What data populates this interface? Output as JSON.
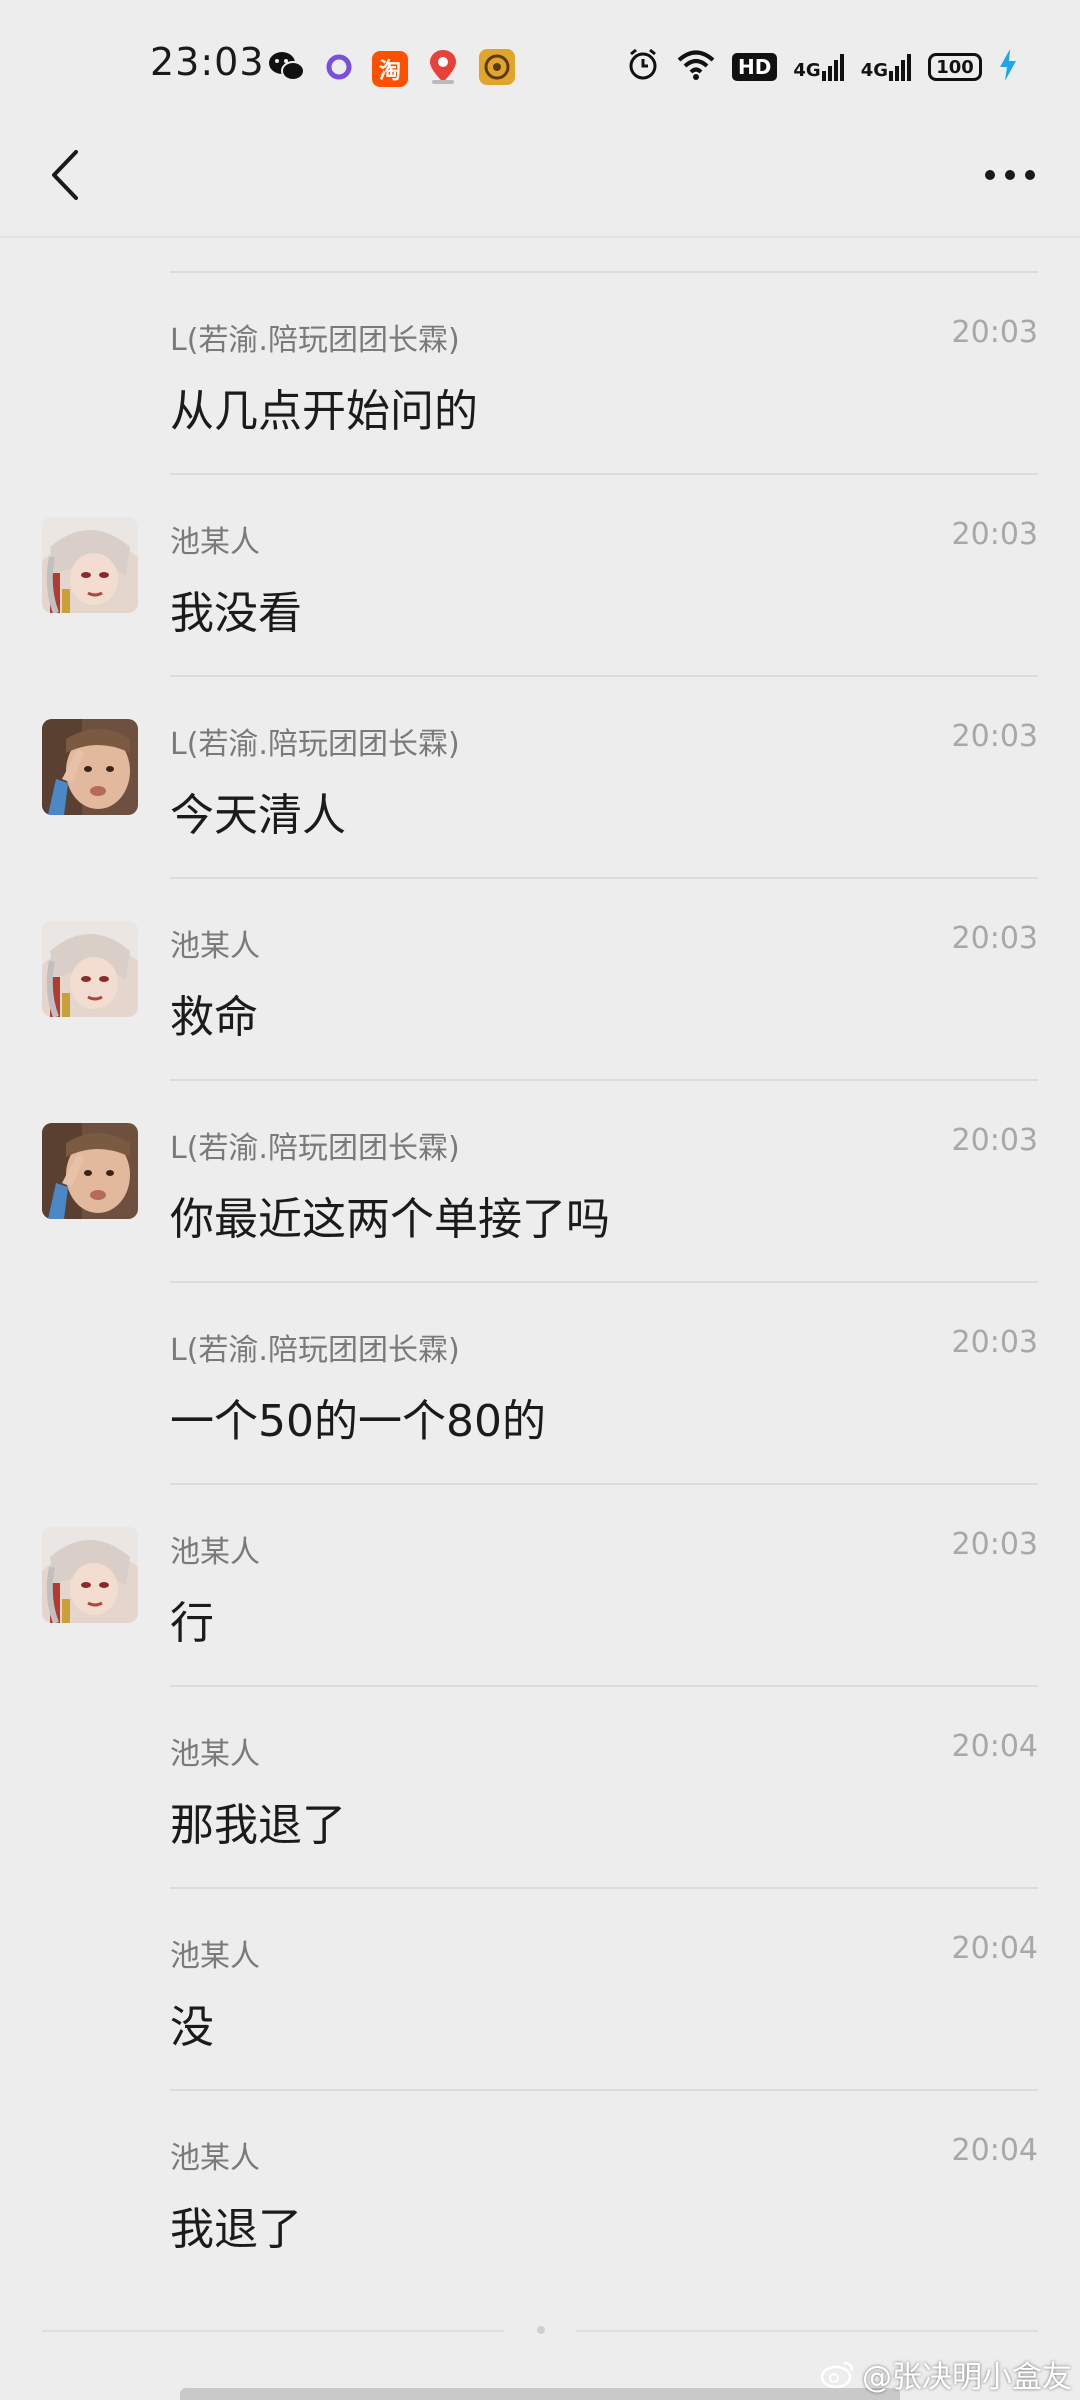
{
  "status_bar": {
    "time": "23:03",
    "taobao_label": "淘",
    "hd_label": "HD",
    "net1_label": "4G",
    "net2_label": "4G",
    "battery_level": "100",
    "icons": [
      "wechat-icon",
      "circle-app-icon",
      "taobao-icon",
      "map-pin-icon",
      "compass-app-icon",
      "alarm-icon",
      "wifi-icon",
      "signal-icon",
      "battery-icon",
      "charging-icon"
    ]
  },
  "nav": {
    "back_icon": "chevron-left-icon",
    "more_icon": "more-dots-icon"
  },
  "messages": [
    {
      "sender": "L(若渝.陪玩团团长霖)",
      "time": "20:03",
      "content": "从几点开始问的",
      "avatar": "none"
    },
    {
      "sender": "池某人",
      "time": "20:03",
      "content": "我没看",
      "avatar": "anime-avatar"
    },
    {
      "sender": "L(若渝.陪玩团团长霖)",
      "time": "20:03",
      "content": "今天清人",
      "avatar": "child-avatar"
    },
    {
      "sender": "池某人",
      "time": "20:03",
      "content": "救命",
      "avatar": "anime-avatar"
    },
    {
      "sender": "L(若渝.陪玩团团长霖)",
      "time": "20:03",
      "content": "你最近这两个单接了吗",
      "avatar": "child-avatar"
    },
    {
      "sender": "L(若渝.陪玩团团长霖)",
      "time": "20:03",
      "content": "一个50的一个80的",
      "avatar": "none"
    },
    {
      "sender": "池某人",
      "time": "20:03",
      "content": "行",
      "avatar": "anime-avatar"
    },
    {
      "sender": "池某人",
      "time": "20:04",
      "content": "那我退了",
      "avatar": "none"
    },
    {
      "sender": "池某人",
      "time": "20:04",
      "content": "没",
      "avatar": "none"
    },
    {
      "sender": "池某人",
      "time": "20:04",
      "content": "我退了",
      "avatar": "none"
    }
  ],
  "watermark": "@张决明小盒友",
  "colors": {
    "background": "#ededed",
    "divider": "#dcdcdc",
    "sender_text": "#7a7a7a",
    "time_text": "#a8a8a8",
    "content_text": "#1b1b1b",
    "taobao_orange": "#ff5000",
    "charging_blue": "#1ea7e8"
  }
}
